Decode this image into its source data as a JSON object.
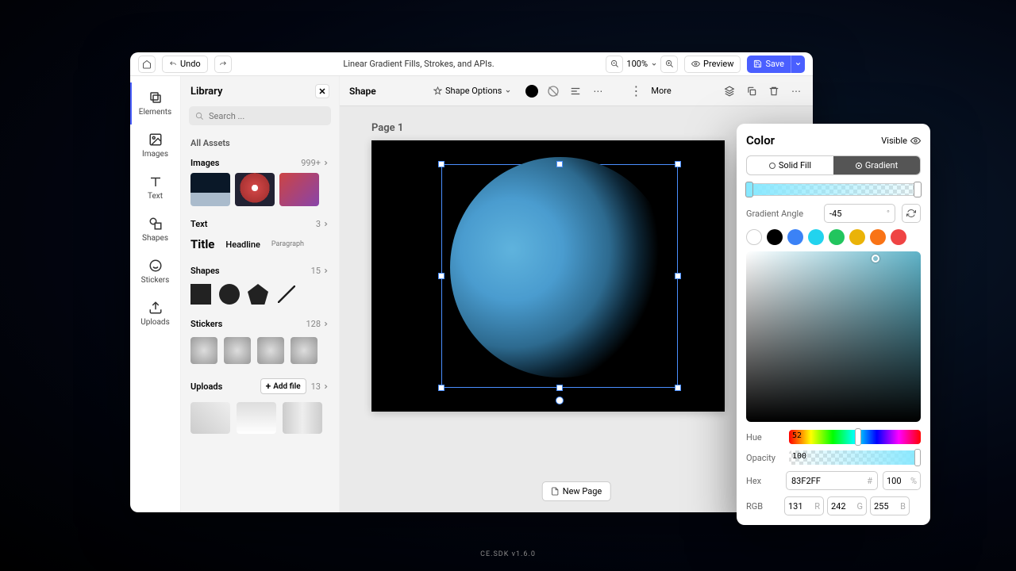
{
  "topbar": {
    "undo_label": "Undo",
    "doc_title": "Linear Gradient Fills, Strokes, and APIs.",
    "zoom_level": "100%",
    "preview_label": "Preview",
    "save_label": "Save"
  },
  "nav": {
    "items": [
      {
        "label": "Elements",
        "icon": "elements-icon"
      },
      {
        "label": "Images",
        "icon": "image-icon"
      },
      {
        "label": "Text",
        "icon": "text-icon"
      },
      {
        "label": "Shapes",
        "icon": "shapes-icon"
      },
      {
        "label": "Stickers",
        "icon": "stickers-icon"
      },
      {
        "label": "Uploads",
        "icon": "upload-icon"
      }
    ]
  },
  "library": {
    "title": "Library",
    "search_placeholder": "Search ...",
    "all_assets_label": "All Assets",
    "sections": {
      "images": {
        "label": "Images",
        "count": "999+"
      },
      "text": {
        "label": "Text",
        "count": "3",
        "samples": {
          "title": "Title",
          "headline": "Headline",
          "paragraph": "Paragraph"
        }
      },
      "shapes": {
        "label": "Shapes",
        "count": "15"
      },
      "stickers": {
        "label": "Stickers",
        "count": "128"
      },
      "uploads": {
        "label": "Uploads",
        "count": "13",
        "add_file": "Add file"
      }
    }
  },
  "shape_toolbar": {
    "label": "Shape",
    "options_label": "Shape Options",
    "more_label": "More"
  },
  "canvas": {
    "page_label": "Page 1",
    "new_page_label": "New Page"
  },
  "color_panel": {
    "title": "Color",
    "visible_label": "Visible",
    "tabs": {
      "solid": "Solid Fill",
      "gradient": "Gradient"
    },
    "gradient_angle_label": "Gradient Angle",
    "gradient_angle_value": "-45",
    "gradient_angle_unit": "°",
    "hue_label": "Hue",
    "hue_value": "52",
    "opacity_label": "Opacity",
    "opacity_value": "100",
    "hex_label": "Hex",
    "hex_value": "83F2FF",
    "hex_unit": "#",
    "hex_opacity": "100",
    "hex_opacity_unit": "%",
    "rgb_label": "RGB",
    "rgb": {
      "r": "131",
      "g": "242",
      "b": "255"
    },
    "swatches": [
      "white",
      "black",
      "blue",
      "cyan",
      "green",
      "yellow",
      "orange",
      "red"
    ]
  },
  "footer": "CE.SDK v1.6.0"
}
